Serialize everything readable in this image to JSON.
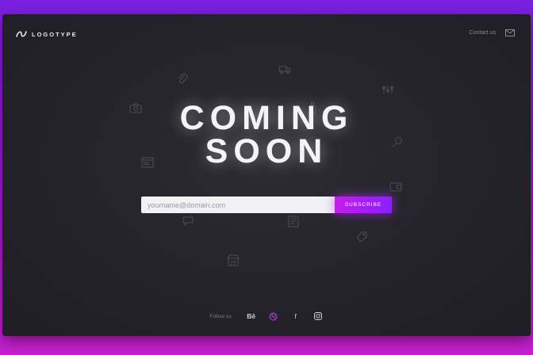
{
  "brand": {
    "logo_text": "LOGOTYPE"
  },
  "header": {
    "contact_label": "Contact us",
    "mail_icon": "mail-icon"
  },
  "hero": {
    "line1": "COMING",
    "line2": "SOON"
  },
  "subscribe_form": {
    "email_placeholder": "yourname@domain.com",
    "email_value": "",
    "button_label": "SUBSCRIBE"
  },
  "footer": {
    "follow_label": "Follow us",
    "socials": [
      {
        "icon": "behance-icon",
        "text": "Bē"
      },
      {
        "icon": "dribbble-icon"
      },
      {
        "icon": "facebook-icon",
        "text": "f"
      },
      {
        "icon": "instagram-icon"
      }
    ]
  },
  "colors": {
    "background_gradient": [
      "#7b1fe0",
      "#c71fd0"
    ],
    "panel": "#24232a",
    "accent_start": "#c21fe8",
    "accent_end": "#8a1fff",
    "dribbble_accent": "#b83cf0",
    "text_primary": "#f4f4f6",
    "text_muted": "#8a8993"
  },
  "decorative_icons": [
    "paperclip-icon",
    "truck-icon",
    "camera-icon",
    "bottle-icon",
    "hanger-icon",
    "magnifier-icon",
    "browser-window-icon",
    "wallet-icon",
    "chat-bubble-icon",
    "document-icon",
    "tag-icon",
    "storefront-icon"
  ]
}
